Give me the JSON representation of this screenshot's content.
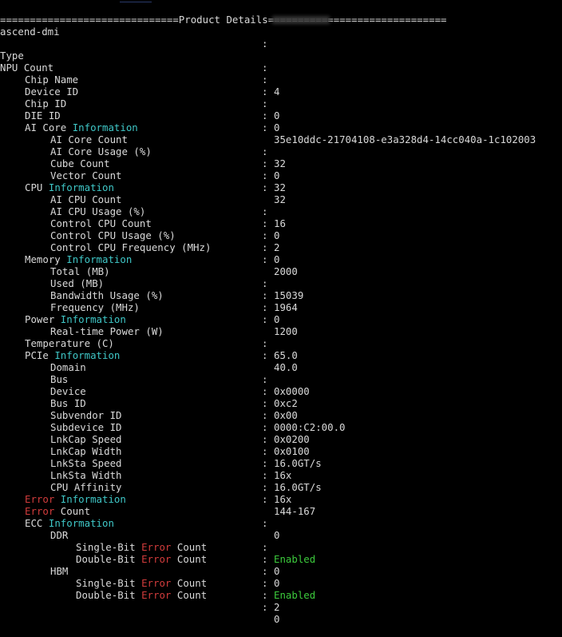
{
  "header": "==============================Product Details==============================",
  "colors": {
    "background": "#000000",
    "text": "#d9d9d9",
    "cyan": "#3fc7c7",
    "red": "#d23c3c",
    "green": "#3ccb3c"
  },
  "rows": [
    {
      "k": "ascend-dmi",
      "v": ""
    },
    {
      "k": "",
      "v": ""
    },
    {
      "k": "Type",
      "v": ""
    },
    {
      "k": "NPU Count",
      "v": "4"
    },
    {
      "k": "Chip Name",
      "v": ""
    },
    {
      "k": "Device ID",
      "v": "0"
    },
    {
      "k": "Chip ID",
      "v": "0"
    },
    {
      "k": "DIE ID",
      "v": "35e10ddc-21704108-e3a328d4-14cc040a-1c102003"
    },
    {
      "k": "AI Core",
      "k2": "Information"
    },
    {
      "k": "AI Core Count",
      "v": "32"
    },
    {
      "k": "AI Core Usage (%)",
      "v": "0"
    },
    {
      "k": "Cube Count",
      "v": "32"
    },
    {
      "k": "Vector Count",
      "v": "32"
    },
    {
      "k": "CPU",
      "k2": "Information"
    },
    {
      "k": "AI CPU Count",
      "v": "16"
    },
    {
      "k": "AI CPU Usage (%)",
      "v": "0"
    },
    {
      "k": "Control CPU Count",
      "v": "2"
    },
    {
      "k": "Control CPU Usage (%)",
      "v": "0"
    },
    {
      "k": "Control CPU Frequency (MHz)",
      "v": "2000"
    },
    {
      "k": "Memory",
      "k2": "Information"
    },
    {
      "k": "Total (MB)",
      "v": "15039"
    },
    {
      "k": "Used (MB)",
      "v": "1964"
    },
    {
      "k": "Bandwidth Usage (%)",
      "v": "0"
    },
    {
      "k": "Frequency (MHz)",
      "v": "1200"
    },
    {
      "k": "Power",
      "k2": "Information"
    },
    {
      "k": "Real-time Power (W)",
      "v": "65.0"
    },
    {
      "k": "Temperature (C)",
      "v": "40.0"
    },
    {
      "k": "PCIe",
      "k2": "Information"
    },
    {
      "k": "Domain",
      "v": "0x0000"
    },
    {
      "k": "Bus",
      "v": "0xc2"
    },
    {
      "k": "Device",
      "v": "0x00"
    },
    {
      "k": "Bus ID",
      "v": "0000:C2:00.0"
    },
    {
      "k": "Subvendor ID",
      "v": "0x0200"
    },
    {
      "k": "Subdevice ID",
      "v": "0x0100"
    },
    {
      "k": "LnkCap Speed",
      "v": "16.0GT/s"
    },
    {
      "k": "LnkCap Width",
      "v": "16x"
    },
    {
      "k": "LnkSta Speed",
      "v": "16.0GT/s"
    },
    {
      "k": "LnkSta Width",
      "v": "16x"
    },
    {
      "k": "CPU Affinity",
      "v": "144-167"
    },
    {
      "k": "Error",
      "k2": "Information"
    },
    {
      "k": "Error",
      "k2": "Count",
      "v": "0"
    },
    {
      "k": "ECC",
      "k2": "Information"
    },
    {
      "k": "DDR",
      "v": "Enabled"
    },
    {
      "k": "Single-Bit",
      "k2": "Error",
      "k3": "Count",
      "v": "0"
    },
    {
      "k": "Double-Bit",
      "k2": "Error",
      "k3": "Count",
      "v": "0"
    },
    {
      "k": "HBM",
      "v": "Enabled"
    },
    {
      "k": "Single-Bit",
      "k2": "Error",
      "k3": "Count",
      "v": "2"
    },
    {
      "k": "Double-Bit",
      "k2": "Error",
      "k3": "Count",
      "v": "0"
    }
  ]
}
